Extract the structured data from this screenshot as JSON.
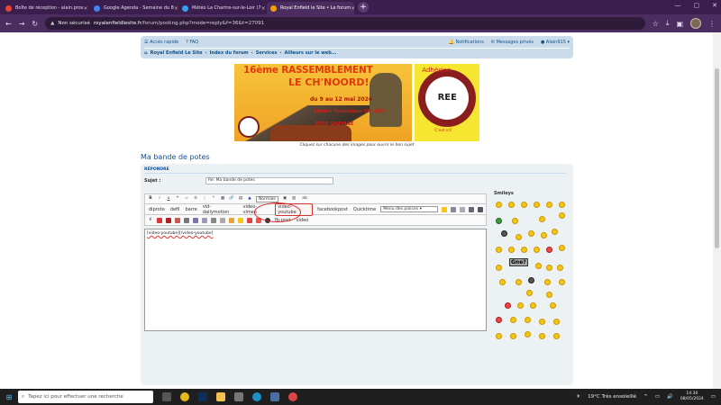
{
  "browser": {
    "tabs": [
      {
        "title": "Boîte de réception - alain.pros",
        "color": "#ea4335"
      },
      {
        "title": "Google Agenda - Semaine du 8",
        "color": "#4285f4"
      },
      {
        "title": "Météo La Chartre-sur-le-Loir (7",
        "color": "#34a0f0"
      },
      {
        "title": "Royal Enfield le Site • Le forum",
        "color": "#f5a000"
      }
    ],
    "active_tab": 3,
    "url_secure_label": "Non sécurisé",
    "url_host": "royalenfieldlesite.fr",
    "url_path": "/forum/posting.php?mode=reply&f=36&t=27091"
  },
  "forum": {
    "quick_links": "Accès rapide",
    "faq": "FAQ",
    "notifications": "Notifications",
    "messages": "Messages privés",
    "user": "Alain915",
    "breadcrumb": [
      "Royal Enfield Le Site",
      "Index du forum",
      "Services",
      "Ailleurs sur le web..."
    ],
    "caption": "Cliquez sur chacune des images pour ouvrir le bon sujet",
    "page_title": "Ma bande de potes",
    "reply_header": "RÉPONDRE",
    "subject_label": "Sujet :",
    "subject_value": "Re: Ma bande de potes",
    "banner": {
      "line1": "16ème RASSEMBLEMENT",
      "line2": "LE CH'NOORD!",
      "dates": "du 9 au 12 mai 2024",
      "place1": "Station Touristique VAL JOLY",
      "place2": "EPPE-SAUVAGE",
      "adhesion": "Adhésion",
      "royal": "ROYAL",
      "assoc": "REE",
      "cest": "C'est ici!"
    },
    "toolbar": {
      "font_size": "Normale",
      "font_select": "Menu des polices",
      "buttons_row2": [
        "dlprote",
        "defil",
        "barre",
        "vid-dailymotion",
        "video-vimeo",
        "video-youtube",
        "facebookpost",
        "Quicktime"
      ],
      "highlighted": "video-youtube",
      "buttons_row3": [
        "fb-post",
        "video"
      ]
    },
    "textarea": "[video-youtube][/video-youtube]",
    "smilies_label": "Smileys",
    "gne": "Gne?"
  },
  "taskbar": {
    "search_placeholder": "Tapez ici pour effectuer une recherche",
    "weather": "19°C  Très ensoleillé",
    "time": "14:30",
    "date": "08/05/2024"
  }
}
